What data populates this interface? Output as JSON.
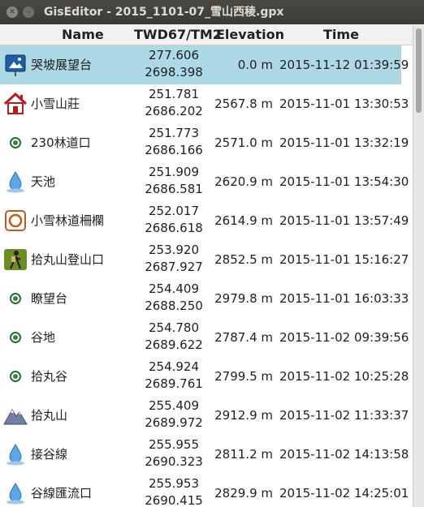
{
  "window": {
    "title": "GisEditor - 2015_1101-07_雪山西稜.gpx",
    "close_glyph": "✕",
    "minimize_glyph": "–"
  },
  "table": {
    "headers": {
      "name": "Name",
      "coord": "TWD67/TM2",
      "elevation": "Elevation",
      "time": "Time"
    },
    "rows": [
      {
        "icon": "scenic-view-sign-icon",
        "name": "哭坡展望台",
        "x": "277.606",
        "y": "2698.398",
        "elevation": "0.0 m",
        "time": "2015-11-12 01:39:59",
        "selected": true
      },
      {
        "icon": "house-icon",
        "name": "小雪山莊",
        "x": "251.781",
        "y": "2686.202",
        "elevation": "2567.8 m",
        "time": "2015-11-01 13:30:53"
      },
      {
        "icon": "waypoint-dot-icon",
        "name": "230林道口",
        "x": "251.773",
        "y": "2686.166",
        "elevation": "2571.0 m",
        "time": "2015-11-01 13:32:19"
      },
      {
        "icon": "water-drop-icon",
        "name": "天池",
        "x": "251.909",
        "y": "2686.581",
        "elevation": "2620.9 m",
        "time": "2015-11-01 13:54:30"
      },
      {
        "icon": "gate-ring-icon",
        "name": "小雪林道柵欄",
        "x": "252.017",
        "y": "2686.618",
        "elevation": "2614.9 m",
        "time": "2015-11-01 13:57:49"
      },
      {
        "icon": "hiker-icon",
        "name": "拾丸山登山口",
        "x": "253.920",
        "y": "2687.927",
        "elevation": "2852.5 m",
        "time": "2015-11-01 15:16:27"
      },
      {
        "icon": "waypoint-dot-icon",
        "name": "瞭望台",
        "x": "254.409",
        "y": "2688.250",
        "elevation": "2979.8 m",
        "time": "2015-11-01 16:03:33"
      },
      {
        "icon": "waypoint-dot-icon",
        "name": "谷地",
        "x": "254.780",
        "y": "2689.622",
        "elevation": "2787.4 m",
        "time": "2015-11-02 09:39:56"
      },
      {
        "icon": "waypoint-dot-icon",
        "name": "拾丸谷",
        "x": "254.924",
        "y": "2689.761",
        "elevation": "2799.5 m",
        "time": "2015-11-02 10:25:28"
      },
      {
        "icon": "mountain-peak-icon",
        "name": "拾丸山",
        "x": "255.409",
        "y": "2689.972",
        "elevation": "2912.9 m",
        "time": "2015-11-02 11:33:37"
      },
      {
        "icon": "water-drop-icon",
        "name": "接谷線",
        "x": "255.955",
        "y": "2690.323",
        "elevation": "2811.2 m",
        "time": "2015-11-02 14:13:58"
      },
      {
        "icon": "water-drop-icon",
        "name": "谷線匯流口",
        "x": "255.953",
        "y": "2690.415",
        "elevation": "2829.9 m",
        "time": "2015-11-02 14:25:01"
      }
    ]
  },
  "colors": {
    "selected_row": "#add8e6",
    "titlebar": "#3c3b37"
  }
}
